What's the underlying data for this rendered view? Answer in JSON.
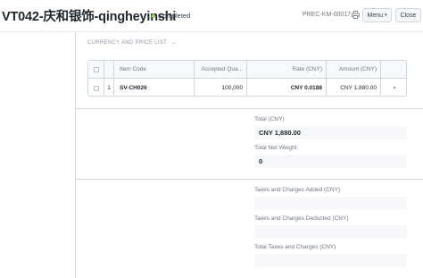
{
  "header": {
    "title": "VT042-庆和银饰-qingheyinshi",
    "status": "Completed",
    "doc_id": "PREC-KM-00017",
    "menu_label": "Menu",
    "close_label": "Close",
    "status_color": "#98d85b"
  },
  "section": {
    "title": "CURRENCY AND PRICE LIST"
  },
  "items_table": {
    "columns": {
      "item_code": "Item Code",
      "accepted_qty": "Accepted Qua...",
      "rate": "Rate (CNY)",
      "amount": "Amount (CNY)"
    },
    "rows": [
      {
        "idx": "1",
        "item_code": "SV-CH026",
        "accepted_qty": "100,000",
        "rate": "CNY 0.0188",
        "amount": "CNY 1,880.00"
      }
    ]
  },
  "totals": {
    "total_label": "Total (CNY)",
    "total_value": "CNY 1,880.00",
    "net_weight_label": "Total Net Weight",
    "net_weight_value": "0"
  },
  "taxes": {
    "added_label": "Taxes and Charges Added (CNY)",
    "added_value": "",
    "deducted_label": "Taxes and Charges Deducted (CNY)",
    "deducted_value": "",
    "total_label": "Total Taxes and Charges (CNY)",
    "total_value": ""
  }
}
